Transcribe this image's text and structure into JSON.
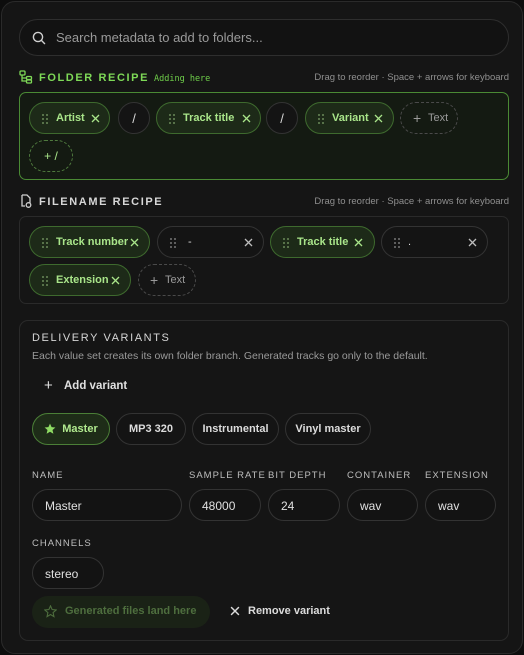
{
  "search": {
    "placeholder": "Search metadata to add to folders..."
  },
  "folder_recipe": {
    "title": "FOLDER RECIPE",
    "badge": "Adding here",
    "hint": "Drag to reorder · Space + arrows for keyboard",
    "chips": [
      {
        "label": "Artist",
        "kind": "token"
      },
      {
        "label": "/",
        "kind": "separator"
      },
      {
        "label": "Track title",
        "kind": "token"
      },
      {
        "label": "/",
        "kind": "separator"
      },
      {
        "label": "Variant",
        "kind": "token"
      }
    ],
    "add_text_label": "Text",
    "add_separator_label": "+ /"
  },
  "filename_recipe": {
    "title": "FILENAME RECIPE",
    "hint": "Drag to reorder · Space + arrows for keyboard",
    "chips": [
      {
        "label": "Track number",
        "kind": "token"
      },
      {
        "label": "-",
        "kind": "literal"
      },
      {
        "label": "Track title",
        "kind": "token"
      },
      {
        "label": ".",
        "kind": "literal"
      },
      {
        "label": "Extension",
        "kind": "token"
      }
    ],
    "add_text_label": "Text"
  },
  "delivery_variants": {
    "title": "DELIVERY VARIANTS",
    "description": "Each value set creates its own folder branch. Generated tracks go only to the default.",
    "add_variant_label": "Add variant",
    "variants": [
      {
        "label": "Master",
        "selected": true,
        "default": true
      },
      {
        "label": "MP3 320",
        "selected": false
      },
      {
        "label": "Instrumental",
        "selected": false
      },
      {
        "label": "Vinyl master",
        "selected": false
      }
    ],
    "fields": {
      "name": {
        "label": "NAME",
        "value": "Master"
      },
      "sample_rate": {
        "label": "SAMPLE RATE",
        "value": "48000"
      },
      "bit_depth": {
        "label": "BIT DEPTH",
        "value": "24"
      },
      "container": {
        "label": "CONTAINER",
        "value": "wav"
      },
      "extension": {
        "label": "EXTENSION",
        "value": "wav"
      },
      "channels": {
        "label": "CHANNELS",
        "value": "stereo"
      }
    },
    "generated_button_label": "Generated files land here",
    "remove_variant_label": "Remove variant"
  },
  "colors": {
    "accent": "#7ed957",
    "background": "#151515",
    "border": "#2a2a2a"
  },
  "icons": {
    "search": "search-icon",
    "folder_recipe": "folder-tree-icon",
    "filename_recipe": "file-recipe-icon",
    "grip": "drag-grip-icon",
    "remove": "close-icon",
    "default_variant": "star-icon"
  }
}
